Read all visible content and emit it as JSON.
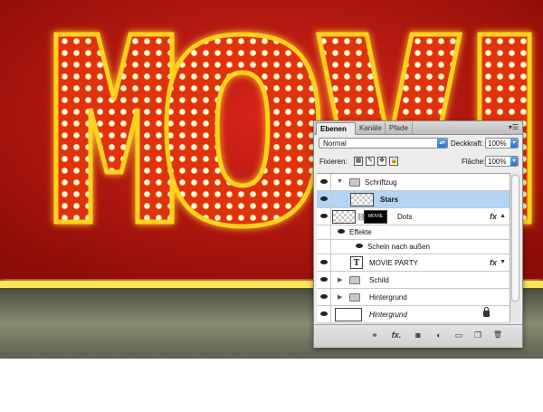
{
  "artwork": {
    "letters": "MOVI"
  },
  "panel": {
    "tabs": [
      {
        "label": "Ebenen",
        "active": true
      },
      {
        "label": "Kanäle",
        "active": false
      },
      {
        "label": "Pfade",
        "active": false
      }
    ],
    "menu_icon": "panel-menu-icon",
    "blend_mode": "Normal",
    "opacity_label": "Deckkraft:",
    "opacity_value": "100%",
    "lock_label": "Fixieren:",
    "fill_label": "Fläche:",
    "fill_value": "100%",
    "layers": [
      {
        "name": "Schriftzug",
        "type": "group",
        "expanded": true,
        "visible": true
      },
      {
        "name": "Stars",
        "type": "layer",
        "selected": true,
        "visible": true
      },
      {
        "name": "Dots",
        "type": "layer",
        "fx": "fx",
        "has_mask": true,
        "mask_text": "MOVIE",
        "visible": true
      },
      {
        "name": "Effekte",
        "type": "effects-header",
        "visible": true
      },
      {
        "name": "Schein nach außen",
        "type": "effect",
        "visible": true
      },
      {
        "name": "MOVIE PARTY",
        "type": "text",
        "thumb_glyph": "T",
        "fx": "fx",
        "visible": true
      },
      {
        "name": "Schild",
        "type": "group",
        "expanded": false,
        "visible": true
      },
      {
        "name": "Hintergrund",
        "type": "group",
        "expanded": false,
        "visible": true
      },
      {
        "name": "Hintergrund",
        "type": "background",
        "locked": true,
        "visible": true
      }
    ],
    "bottom_icons": [
      "link-icon",
      "fx-icon",
      "mask-icon",
      "adjustment-icon",
      "group-icon",
      "new-layer-icon",
      "delete-icon"
    ],
    "bottom_glyphs": {
      "link": "⚭",
      "fx": "fx.",
      "mask": "◙",
      "adjust": "◐",
      "group": "▭",
      "new": "❐",
      "delete": "🗑"
    }
  },
  "colors": {
    "selection": "#b5d3f7",
    "accent": "#3b7be0"
  }
}
